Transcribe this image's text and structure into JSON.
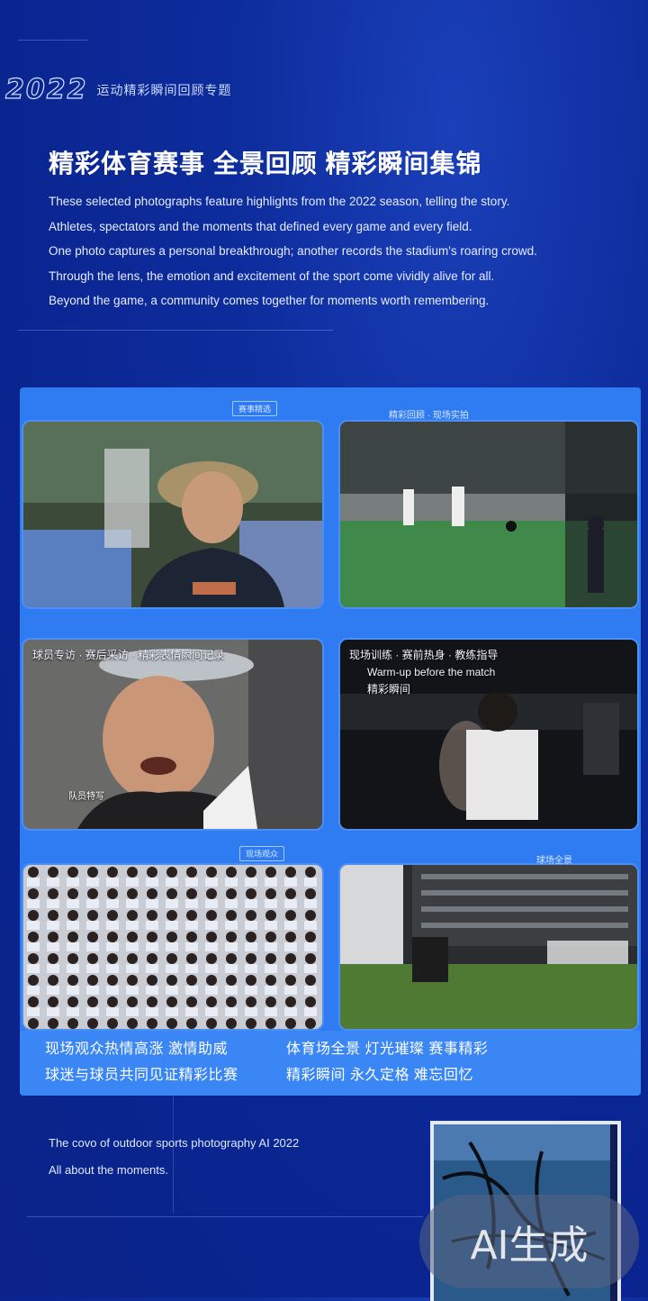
{
  "brand": {
    "number": "2022",
    "subtitle": "运动精彩瞬间回顾专题"
  },
  "headline": "精彩体育赛事 全景回顾 精彩瞬间集锦",
  "intro": [
    "These selected photographs feature highlights from the 2022 season, telling the story.",
    "Athletes, spectators and the moments that defined every game and every field.",
    "One photo captures a personal breakthrough; another records the stadium's roaring crowd.",
    "Through the lens, the emotion and excitement of the sport come vividly alive for all.",
    "Beyond the game, a community comes together for moments worth remembering."
  ],
  "gallery": {
    "tab_top_left": "赛事精选",
    "tab_top_right": "精彩回顾 · 现场实拍",
    "tab_mid": "现场观众",
    "tab_mid_right": "球场全景",
    "tile_overlay_left": "球员专访 · 赛后采访 · 精彩表情瞬间记录",
    "tile_overlay_right": [
      "现场训练 · 赛前热身 · 教练指导",
      "Warm-up before the match",
      "精彩瞬间"
    ],
    "tile_caption_small": "队员特写",
    "captions_left": [
      "现场观众热情高涨 激情助威",
      "球迷与球员共同见证精彩比赛"
    ],
    "captions_right": [
      "体育场全景 灯光璀璨 赛事精彩",
      "精彩瞬间 永久定格 难忘回忆"
    ]
  },
  "footer": {
    "line1": "The covo of outdoor sports photography AI 2022",
    "line2": "All about the moments."
  },
  "watermark": "AI生成"
}
